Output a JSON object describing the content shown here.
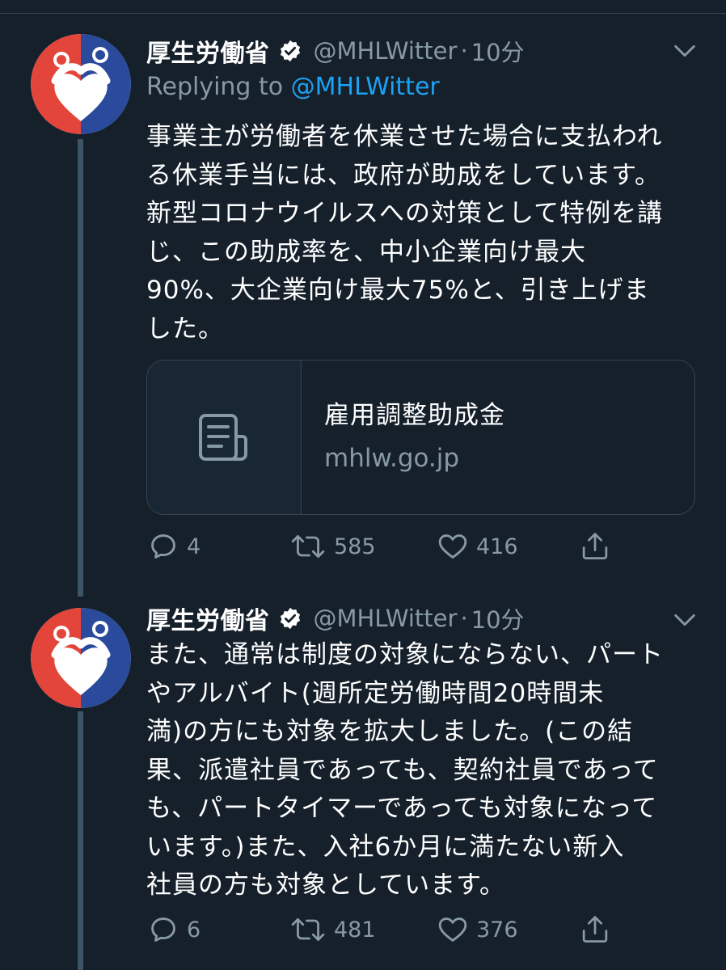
{
  "colors": {
    "background": "#15202b",
    "border": "#38444d",
    "muted": "#8899a6",
    "link": "#1da1f2",
    "thread_line": "#3d5466"
  },
  "tweets": [
    {
      "display_name": "厚生労働省",
      "verified_icon": "verified-badge-icon",
      "handle": "@MHLWitter",
      "separator": "·",
      "time": "10分",
      "replying_prefix": "Replying to ",
      "replying_to": "@MHLWitter",
      "text": "事業主が労働者を休業させた場合に支払われ\nる休業手当には、政府が助成をしています。\n新型コロナウイルスへの対策として特例を講\nじ、この助成率を、中小企業向け最大\n90%、大企業向け最大75%と、引き上げま\nした。",
      "card": {
        "icon": "document-icon",
        "title": "雇用調整助成金",
        "domain": "mhlw.go.jp"
      },
      "replies": "4",
      "retweets": "585",
      "likes": "416"
    },
    {
      "display_name": "厚生労働省",
      "verified_icon": "verified-badge-icon",
      "handle": "@MHLWitter",
      "separator": "·",
      "time": "10分",
      "text": "また、通常は制度の対象にならない、パート\nやアルバイト(週所定労働時間20時間未\n満)の方にも対象を拡大しました。(この結\n果、派遣社員であっても、契約社員であって\nも、パートタイマーであっても対象になって\nいます。)また、入社6か月に満たない新入\n社員の方も対象としています。",
      "replies": "6",
      "retweets": "481",
      "likes": "376"
    }
  ]
}
